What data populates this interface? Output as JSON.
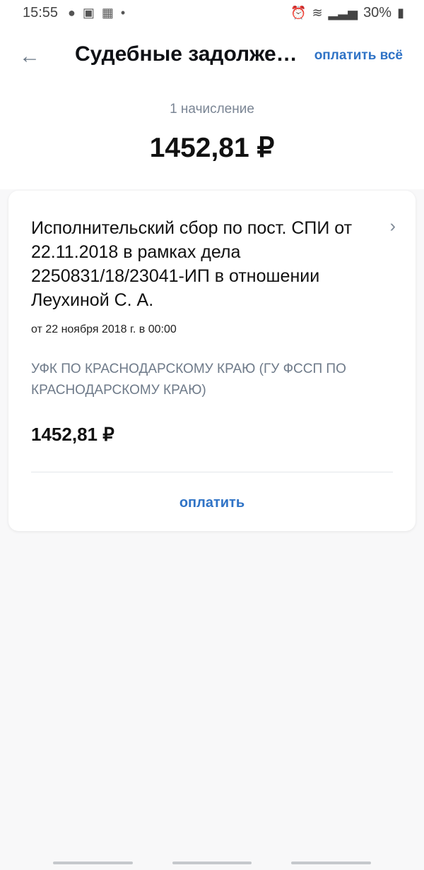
{
  "status_bar": {
    "time": "15:55",
    "battery": "30%"
  },
  "header": {
    "title": "Судебные задолженн...",
    "pay_all": "оплатить всё"
  },
  "summary": {
    "count": "1 начисление",
    "total": "1452,81 ₽"
  },
  "charge": {
    "title": "Исполнительский сбор по пост. СПИ от 22.11.2018 в рамках дела 2250831/18/23041-ИП в отношении Леухиной С. А.",
    "date": "от 22 ноября 2018 г. в 00:00",
    "recipient": "УФК ПО КРАСНОДАРСКОМУ КРАЮ (ГУ ФССП ПО КРАСНОДАРСКОМУ КРАЮ)",
    "amount": "1452,81 ₽",
    "pay": "оплатить"
  }
}
